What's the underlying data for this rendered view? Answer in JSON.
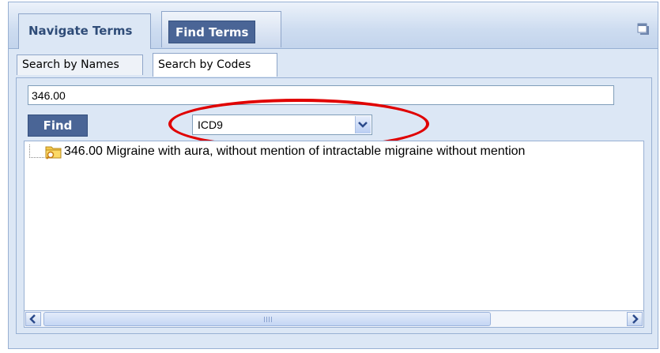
{
  "outer_tabs": {
    "navigate": "Navigate Terms",
    "find": "Find Terms"
  },
  "inner_tabs": {
    "names": "Search by Names",
    "codes": "Search by Codes"
  },
  "search": {
    "value": "346.00"
  },
  "find_button": "Find",
  "code_system": {
    "selected": "ICD9"
  },
  "results": [
    {
      "label": "346.00 Migraine with aura, without mention of intractable migraine without mention"
    }
  ],
  "icons": {
    "restore": "restore-window-icon",
    "folder": "folder-search-icon",
    "dropdown": "chevron-down-icon",
    "scroll_left": "arrow-left-icon",
    "scroll_right": "arrow-right-icon"
  },
  "colors": {
    "accent": "#4a6596",
    "panel": "#dce7f5",
    "highlight": "#e00000"
  }
}
